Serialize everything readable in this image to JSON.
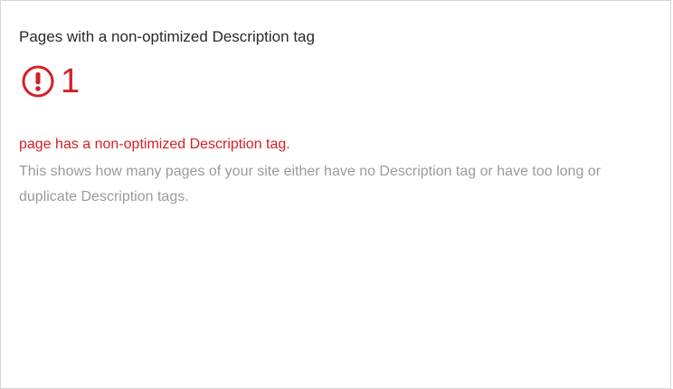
{
  "card": {
    "title": "Pages with a non-optimized Description tag",
    "count": "1",
    "status_text": "page has a non-optimized Description tag.",
    "description": "This shows how many pages of your site either have no Description tag or have too long or duplicate Description tags.",
    "icon": "alert-circle-icon",
    "accent_color": "#d32026",
    "muted_color": "#9b9b9b"
  }
}
